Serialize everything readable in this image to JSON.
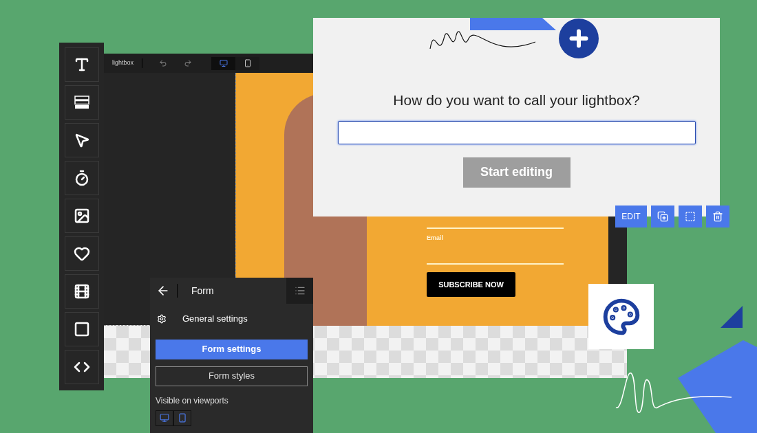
{
  "editor": {
    "title": "lightbox",
    "viewports": [
      {
        "kind": "desktop",
        "selected": true
      },
      {
        "kind": "mobile",
        "selected": false
      }
    ]
  },
  "lightbox_preview": {
    "email_label": "Email",
    "subscribe_button": "SUBSCRIBE NOW"
  },
  "name_dialog": {
    "title": "How do you want to call your lightbox?",
    "button": {
      "label": "Start editing",
      "disabled": true
    }
  },
  "element_toolbar": {
    "edit_button": "EDIT"
  },
  "form_panel": {
    "title": "Form",
    "general": "General settings",
    "tabs": [
      {
        "label": "Form settings",
        "selected": true
      },
      {
        "label": "Form styles",
        "selected": false
      }
    ],
    "viewports_label": "Visible on viewports",
    "viewports": [
      {
        "kind": "desktop"
      },
      {
        "kind": "mobile"
      }
    ]
  }
}
